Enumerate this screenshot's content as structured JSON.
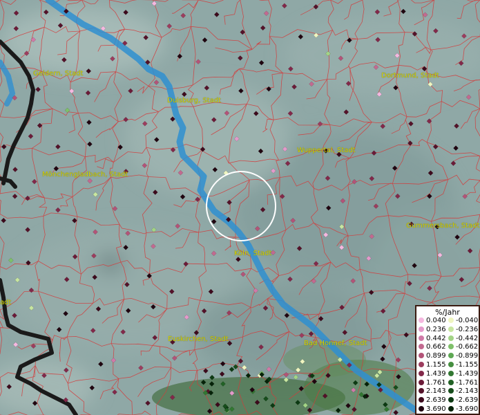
{
  "map": {
    "cities": [
      {
        "name": "Geldern, Stadt"
      },
      {
        "name": "Duisburg, Stadt"
      },
      {
        "name": "Dortmund, Stadt"
      },
      {
        "name": "Wuppertal, Stadt"
      },
      {
        "name": "Mönchengladbach, Stadt"
      },
      {
        "name": "Gummersbach, Stadt"
      },
      {
        "name": "Köln, Stadt"
      },
      {
        "name": "Euskirchen, Stadt"
      },
      {
        "name": "Bad Honnef, Stadt"
      },
      {
        "name": "adt"
      }
    ],
    "colors": {
      "river": "#2f8fd0",
      "border_lines": "#d43a3a",
      "country_border": "#1a1a1a",
      "terrain": "#8fa8a6",
      "city_label": "#d8d400",
      "marker_circle": "#ffffff"
    }
  },
  "legend": {
    "title": "%/Jahr",
    "positive": [
      {
        "label": "0.040",
        "color": "#f5b8e0"
      },
      {
        "label": "0.236",
        "color": "#e49acb"
      },
      {
        "label": "0.442",
        "color": "#d07aa8"
      },
      {
        "label": "0.662",
        "color": "#c26a90"
      },
      {
        "label": "0.899",
        "color": "#b35478"
      },
      {
        "label": "1.155",
        "color": "#9c3d5e"
      },
      {
        "label": "1.439",
        "color": "#82294a"
      },
      {
        "label": "1.761",
        "color": "#6b1b38"
      },
      {
        "label": "2.143",
        "color": "#541229"
      },
      {
        "label": "2.639",
        "color": "#3d0a1c"
      },
      {
        "label": "3.690",
        "color": "#200510"
      }
    ],
    "negative": [
      {
        "label": "-0.040",
        "color": "#eff5c0"
      },
      {
        "label": "-0.236",
        "color": "#c8e6a0"
      },
      {
        "label": "-0.442",
        "color": "#a3d486"
      },
      {
        "label": "-0.662",
        "color": "#7fc06a"
      },
      {
        "label": "-0.899",
        "color": "#5ea854"
      },
      {
        "label": "-1.155",
        "color": "#468f40"
      },
      {
        "label": "-1.439",
        "color": "#327832"
      },
      {
        "label": "-1.761",
        "color": "#226226"
      },
      {
        "label": "-2.143",
        "color": "#164d1b"
      },
      {
        "label": "-2.639",
        "color": "#0c3a12"
      },
      {
        "label": "-3.690",
        "color": "#052208"
      }
    ]
  }
}
